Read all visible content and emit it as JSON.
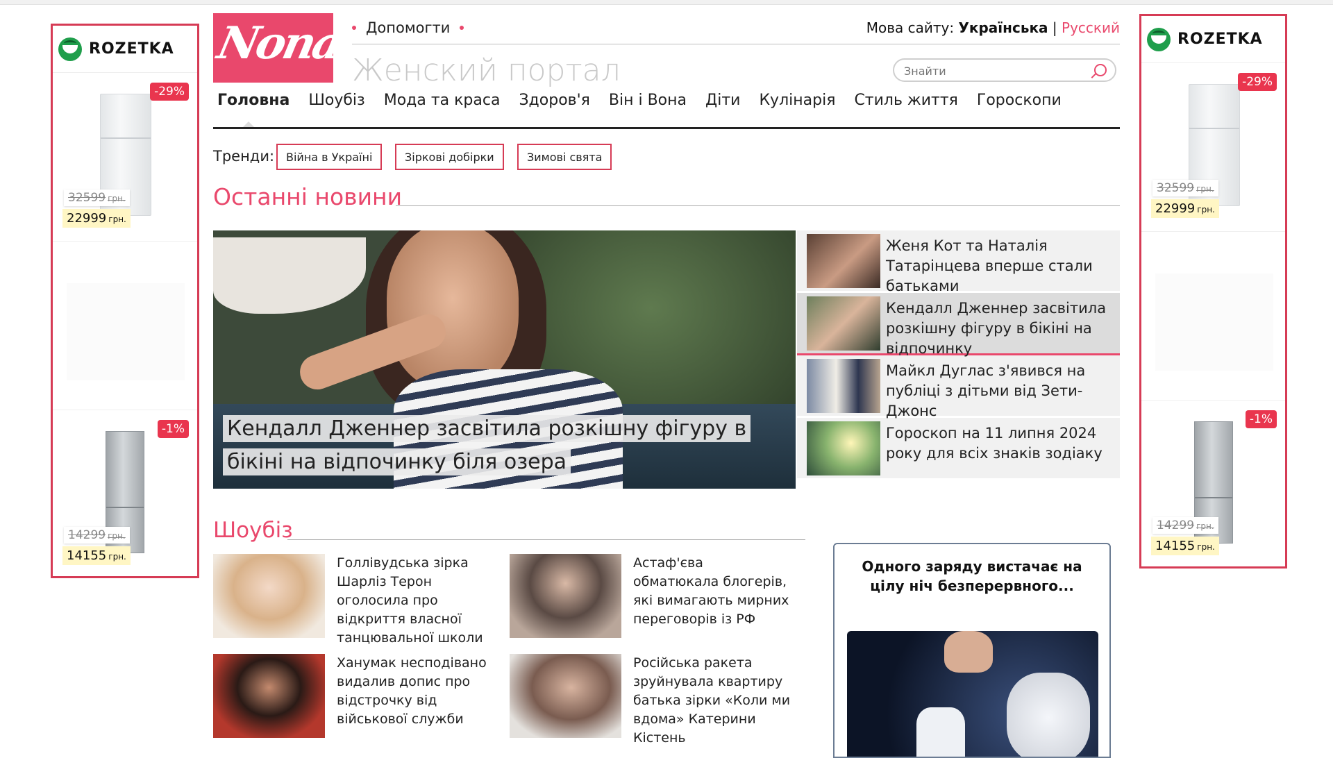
{
  "ads": {
    "brand": "ROZETKA",
    "left": {
      "top_badge": "-29%",
      "top_old": "32599",
      "top_new": "22999",
      "bottom_badge": "-1%",
      "bottom_old": "14299",
      "bottom_new": "14155",
      "currency": "грн."
    },
    "right": {
      "top_badge": "-29%",
      "top_old": "32599",
      "top_new": "22999",
      "bottom_badge": "-1%",
      "bottom_old": "14299",
      "bottom_new": "14155",
      "currency": "грн."
    },
    "promo_title": "Одного заряду вистачає на цілу ніч безперервного..."
  },
  "header": {
    "logo_text": "Nona",
    "help_label": "Допомогти",
    "lang_prefix": "Мова сайту:",
    "lang_current": "Українська",
    "lang_sep": "|",
    "lang_other": "Русский",
    "portal_title": "Женский портал",
    "search_placeholder": "Знайти"
  },
  "nav": [
    "Головна",
    "Шоубіз",
    "Мода та краса",
    "Здоров'я",
    "Він і Вона",
    "Діти",
    "Кулінарія",
    "Стиль життя",
    "Гороскопи"
  ],
  "trends": {
    "label": "Тренди:",
    "items": [
      "Війна в Україні",
      "Зіркові добірки",
      "Зимові свята"
    ]
  },
  "latest": {
    "title": "Останні новини",
    "hero_caption": "Кендалл Дженнер засвітила розкішну фігуру в бікіні на відпочинку біля озера",
    "items": [
      "Женя Кот та Наталія Татарінцева вперше стали батьками",
      "Кендалл Дженнер засвітила розкішну фігуру в бікіні на відпочинку",
      "Майкл Дуглас з'явився на публіці з дітьми від Зети-Джонс",
      "Гороскоп на 11 липня 2024 року для всіх знаків зодіаку"
    ]
  },
  "showbiz": {
    "title": "Шоубіз",
    "cards": [
      "Голлівудська зірка Шарліз Терон оголосила про відкриття власної танцювальної школи",
      "Астаф'єва обматюкала блогерів, які вимагають мирних переговорів із РФ",
      "Ханумак несподівано видалив допис про відстрочку від військової служби",
      "Російська ракета зруйнувала квартиру батька зірки «Коли ми вдома» Катерини Кістень"
    ]
  },
  "colors": {
    "accent": "#e9486c",
    "ad_border": "#d63b55"
  }
}
